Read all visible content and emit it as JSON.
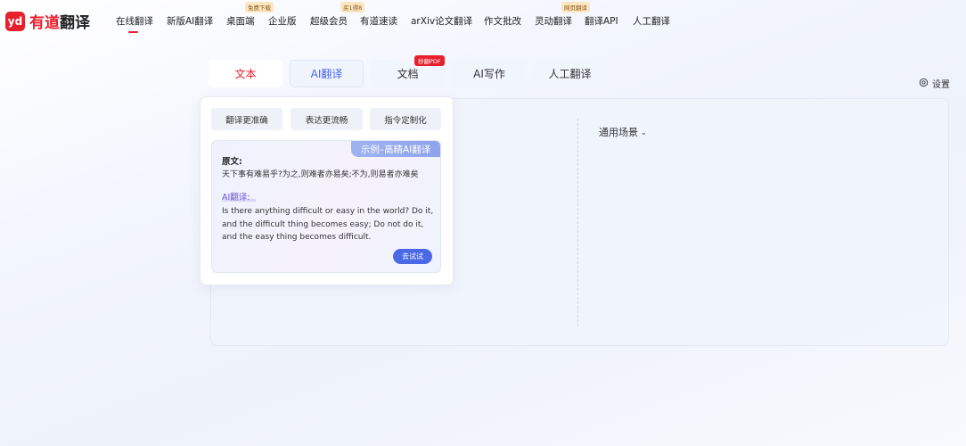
{
  "brand": {
    "mark": "yd",
    "name_part1": "有道",
    "name_part2": "翻译"
  },
  "nav": {
    "items": [
      {
        "label": "在线翻译",
        "active": true
      },
      {
        "label": "新版AI翻译"
      },
      {
        "label": "桌面端",
        "badge": "免费下载"
      },
      {
        "label": "企业版"
      },
      {
        "label": "超级会员",
        "badge": "买1得8"
      },
      {
        "label": "有道速读"
      },
      {
        "label": "arXiv论文翻译"
      },
      {
        "label": "作文批改"
      },
      {
        "label": "灵动翻译",
        "badge": "网页翻译"
      },
      {
        "label": "翻译API"
      },
      {
        "label": "人工翻译"
      }
    ]
  },
  "tabs": {
    "text": "文本",
    "ai": "AI翻译",
    "doc": "文档",
    "doc_badge": "秒翻PDF",
    "writing": "AI写作",
    "human": "人工翻译"
  },
  "settings": {
    "label": "设置",
    "icon": "gear-icon"
  },
  "scene": {
    "label": "通用场景",
    "icon": "chevron-down-icon"
  },
  "dropdown": {
    "features": [
      "翻译更准确",
      "表达更流畅",
      "指令定制化"
    ],
    "example_tag": "示例–高精AI翻译",
    "source_label": "原文:",
    "source_text": "天下事有难易乎?为之,则难者亦易矣;不为,则易者亦难矣",
    "ai_label": "AI翻译:",
    "ai_lines": [
      "Is there anything difficult or easy in the world? Do it,",
      "and the difficult thing becomes easy; Do not do it,",
      "and the easy thing becomes difficult."
    ],
    "try_button": "去试试"
  },
  "colors": {
    "brand_red": "#e8202c",
    "accent_blue": "#4b68e6",
    "ai_purple": "#6b56d8"
  }
}
